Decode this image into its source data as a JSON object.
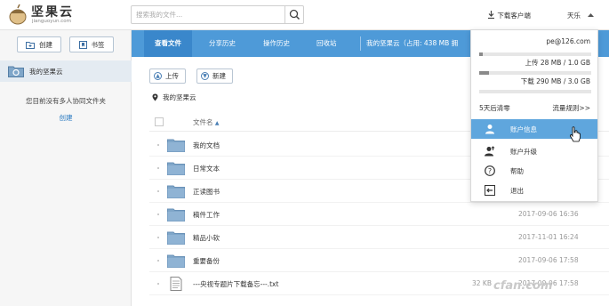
{
  "header": {
    "logo_name": "坚果云",
    "logo_url": "jianguoyun.com",
    "search_placeholder": "搜索我的文件...",
    "download_client": "下载客户端",
    "user_name": "天乐"
  },
  "sidebar": {
    "create_label": "创建",
    "bookmark_label": "书签",
    "my_nut_label": "我的坚果云",
    "no_shared_text": "您目前没有多人协同文件夹",
    "create_link": "创建"
  },
  "tabs": [
    {
      "label": "查看文件"
    },
    {
      "label": "分享历史"
    },
    {
      "label": "操作历史"
    },
    {
      "label": "回收站"
    }
  ],
  "usage_text": "我的坚果云（占用: 438 MB  拥",
  "toolbar": {
    "upload_label": "上传",
    "new_label": "新建"
  },
  "breadcrumb": "我的坚果云",
  "list": {
    "column_name": "文件名",
    "rows": [
      {
        "name": "我的文档",
        "date": "",
        "size": "",
        "type": "folder"
      },
      {
        "name": "日常文本",
        "date": "",
        "size": "",
        "type": "folder"
      },
      {
        "name": "正读图书",
        "date": "",
        "size": "",
        "type": "folder"
      },
      {
        "name": "稿件工作",
        "date": "2017-09-06 16:36",
        "size": "",
        "type": "folder"
      },
      {
        "name": "精品小软",
        "date": "2017-11-01 16:24",
        "size": "",
        "type": "folder"
      },
      {
        "name": "重要备份",
        "date": "2017-09-06 17:58",
        "size": "",
        "type": "folder"
      },
      {
        "name": "---央视专题片下载备忘---.txt",
        "date": "2017-09-06 17:58",
        "size": "32 KB",
        "type": "file"
      }
    ]
  },
  "dropdown": {
    "email": "pe@126.com",
    "upload_usage": "上传 28 MB / 1.0 GB",
    "upload_fraction": 0.03,
    "download_usage": "下载 290 MB / 3.0 GB",
    "download_fraction": 0.09,
    "reset_text": "5天后清零",
    "rules_link": "流量规则>>",
    "items": [
      {
        "label": "账户信息"
      },
      {
        "label": "账户升级"
      },
      {
        "label": "帮助"
      },
      {
        "label": "退出"
      }
    ]
  },
  "watermark": "cfan.com"
}
